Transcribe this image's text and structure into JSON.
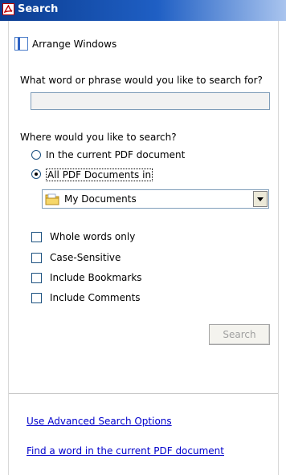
{
  "window": {
    "title": "Search",
    "title_icon": "adobe-pdf-icon"
  },
  "arrange": {
    "icon": "arrange-windows-icon",
    "label": "Arrange Windows"
  },
  "search": {
    "question": "What word or phrase would you like to search for?",
    "value": "",
    "placeholder": ""
  },
  "where": {
    "label": "Where would you like to search?",
    "options": [
      {
        "label": "In the current PDF document",
        "selected": false
      },
      {
        "label": "All PDF Documents in",
        "selected": true
      }
    ],
    "location": {
      "icon": "my-documents-folder-icon",
      "value": "My Documents"
    }
  },
  "checkboxes": [
    {
      "label": "Whole words only",
      "checked": false
    },
    {
      "label": "Case-Sensitive",
      "checked": false
    },
    {
      "label": "Include Bookmarks",
      "checked": false
    },
    {
      "label": "Include Comments",
      "checked": false
    }
  ],
  "search_button": {
    "label": "Search",
    "enabled": false
  },
  "links": {
    "advanced": "Use Advanced Search Options",
    "find": "Find a word in the current PDF document"
  },
  "colors": {
    "titlebar": "#0b3d91",
    "link": "#0000cc",
    "disabled_text": "#a0a0a0"
  }
}
